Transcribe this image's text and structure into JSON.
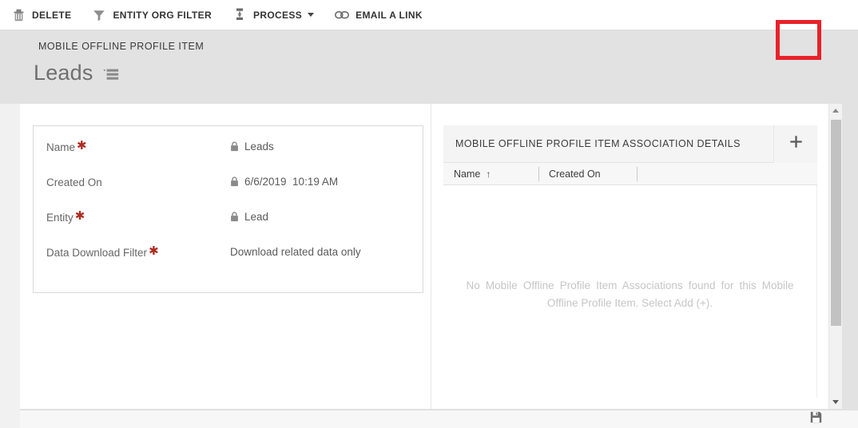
{
  "command_bar": {
    "buttons": [
      {
        "id": "delete",
        "label": "DELETE",
        "icon": "trash-icon",
        "has_caret": false
      },
      {
        "id": "entity-org-filter",
        "label": "ENTITY ORG FILTER",
        "icon": "funnel-icon",
        "has_caret": false
      },
      {
        "id": "process",
        "label": "PROCESS",
        "icon": "process-icon",
        "has_caret": true
      },
      {
        "id": "email-a-link",
        "label": "EMAIL A LINK",
        "icon": "link-icon",
        "has_caret": false
      }
    ]
  },
  "header": {
    "breadcrumb": "MOBILE OFFLINE PROFILE ITEM",
    "title": "Leads",
    "form_selector_icon": "form-selector-icon"
  },
  "form": {
    "fields": [
      {
        "label": "Name",
        "required": true,
        "locked": true,
        "value": "Leads"
      },
      {
        "label": "Created On",
        "required": false,
        "locked": true,
        "value": "6/6/2019  10:19 AM"
      },
      {
        "label": "Entity",
        "required": true,
        "locked": true,
        "value": "Lead"
      },
      {
        "label": "Data Download Filter",
        "required": true,
        "locked": false,
        "value": "Download related data only"
      }
    ]
  },
  "subgrid": {
    "title": "MOBILE OFFLINE PROFILE ITEM ASSOCIATION DETAILS",
    "add_button_label": "+",
    "add_button_icon": "plus-icon",
    "columns": [
      {
        "label": "Name",
        "sorted": true,
        "sort_glyph": "↑"
      },
      {
        "label": "Created On",
        "sorted": false,
        "sort_glyph": ""
      },
      {
        "label": "",
        "sorted": false,
        "sort_glyph": ""
      }
    ],
    "rows": [],
    "empty_message": "No Mobile Offline Profile Item Associations found for this Mobile Offline Profile Item. Select Add (+)."
  },
  "scrollbar": {
    "up_arrow_icon": "chevron-up-icon",
    "down_arrow_icon": "chevron-down-icon"
  },
  "status_bar": {
    "save_icon": "save-icon"
  },
  "colors": {
    "highlight": "#e8222a",
    "required_star": "#b02a1e",
    "page_background": "#e2e2e2",
    "panel_background": "#ffffff",
    "grid_header": "#f4f4f4"
  }
}
